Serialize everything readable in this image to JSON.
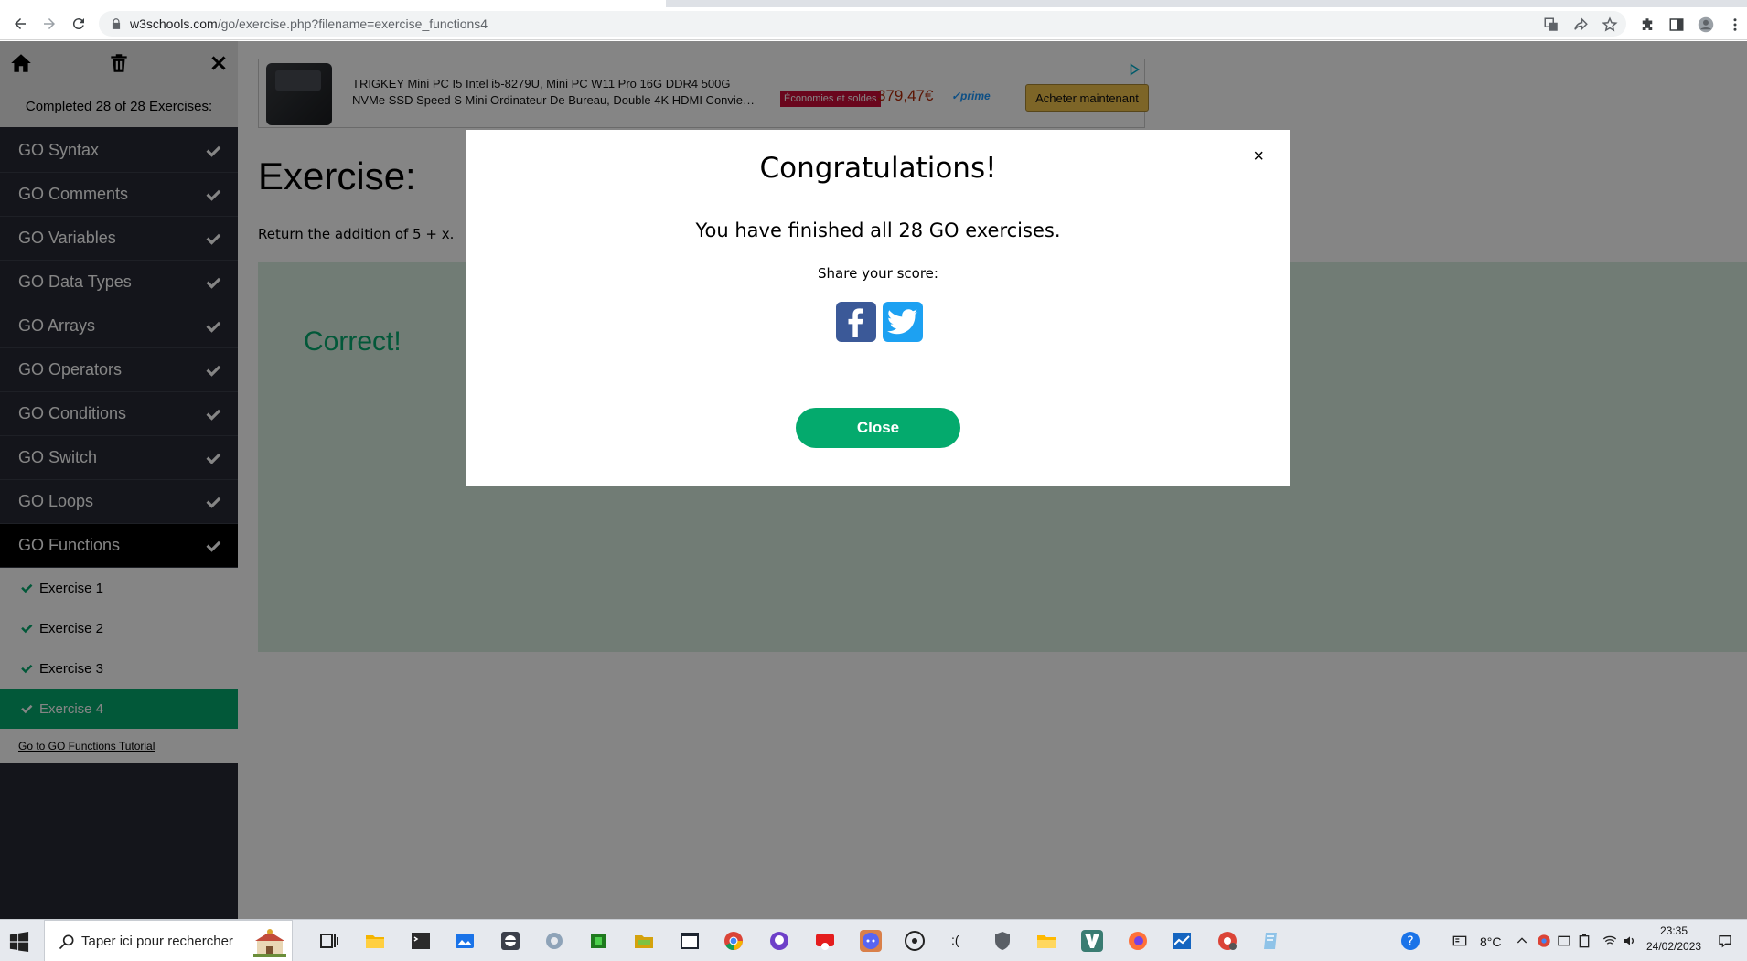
{
  "browser": {
    "url_host": "w3schools.com",
    "url_path": "/go/exercise.php?filename=exercise_functions4"
  },
  "sidebar": {
    "completed_text": "Completed 28 of 28 Exercises:",
    "items": [
      {
        "label": "GO Syntax"
      },
      {
        "label": "GO Comments"
      },
      {
        "label": "GO Variables"
      },
      {
        "label": "GO Data Types"
      },
      {
        "label": "GO Arrays"
      },
      {
        "label": "GO Operators"
      },
      {
        "label": "GO Conditions"
      },
      {
        "label": "GO Switch"
      },
      {
        "label": "GO Loops"
      },
      {
        "label": "GO Functions"
      }
    ],
    "sub_items": [
      {
        "label": "Exercise 1"
      },
      {
        "label": "Exercise 2"
      },
      {
        "label": "Exercise 3"
      },
      {
        "label": "Exercise 4"
      }
    ],
    "tutorial_link": "Go to GO Functions Tutorial"
  },
  "ad": {
    "line1": "TRIGKEY Mini PC I5 Intel i5-8279U, Mini PC W11 Pro 16G DDR4 500G",
    "line2": "NVMe SSD Speed S Mini Ordinateur De Bureau, Double 4K HDMI Convie…",
    "promo": "Économies et soldes",
    "price": "379,47€",
    "prime": "✓prime",
    "buy_label": "Acheter maintenant"
  },
  "main": {
    "title": "Exercise:",
    "description": "Return the addition of 5 + x.",
    "result": "Correct!"
  },
  "modal": {
    "close_x": "×",
    "title": "Congratulations!",
    "message": "You have finished all 28 GO exercises.",
    "share_label": "Share your score:",
    "close_label": "Close"
  },
  "taskbar": {
    "search_placeholder": "Taper ici pour rechercher",
    "weather": "8°C",
    "time": "23:35",
    "date": "24/02/2023"
  },
  "colors": {
    "accent": "#04aa6d",
    "sidebar_bg": "#282a35",
    "facebook": "#3b5998",
    "twitter": "#1da1f2"
  }
}
